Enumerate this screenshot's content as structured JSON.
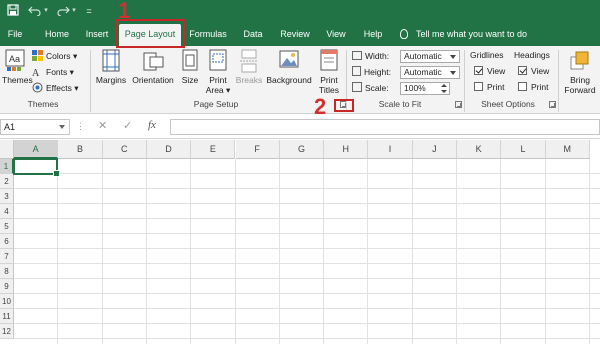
{
  "quick_access": {
    "save_icon": "save-icon",
    "undo_icon": "undo-icon",
    "redo_icon": "redo-icon",
    "customize_icon": "customize-icon"
  },
  "tabs": [
    {
      "label": "File"
    },
    {
      "label": "Home"
    },
    {
      "label": "Insert"
    },
    {
      "label": "Page Layout",
      "active": true
    },
    {
      "label": "Formulas"
    },
    {
      "label": "Data"
    },
    {
      "label": "Review"
    },
    {
      "label": "View"
    },
    {
      "label": "Help"
    }
  ],
  "tell_me": "Tell me what you want to do",
  "annotations": {
    "step1": "1",
    "step2": "2"
  },
  "ribbon": {
    "themes": {
      "themes_label": "Themes",
      "colors_label": "Colors",
      "fonts_label": "Fonts",
      "effects_label": "Effects",
      "group_label": "Themes"
    },
    "page_setup": {
      "margins_label": "Margins",
      "orientation_label": "Orientation",
      "size_label": "Size",
      "print_area_line1": "Print",
      "print_area_line2": "Area",
      "breaks_label": "Breaks",
      "background_label": "Background",
      "print_titles_line1": "Print",
      "print_titles_line2": "Titles",
      "group_label": "Page Setup"
    },
    "scale_to_fit": {
      "width_label": "Width:",
      "width_value": "Automatic",
      "height_label": "Height:",
      "height_value": "Automatic",
      "scale_label": "Scale:",
      "scale_value": "100%",
      "group_label": "Scale to Fit"
    },
    "sheet_options": {
      "gridlines_head": "Gridlines",
      "headings_head": "Headings",
      "view_label": "View",
      "print_label": "Print",
      "gridlines_view": true,
      "gridlines_print": false,
      "headings_view": true,
      "headings_print": false,
      "group_label": "Sheet Options"
    },
    "arrange": {
      "bring_forward_line1": "Bring",
      "bring_forward_line2": "Forward"
    }
  },
  "formula_bar": {
    "name_box": "A1",
    "cancel_icon": "✕",
    "enter_icon": "✓",
    "fx_label": "fx",
    "formula": ""
  },
  "grid": {
    "columns": [
      "A",
      "B",
      "C",
      "D",
      "E",
      "F",
      "G",
      "H",
      "I",
      "J",
      "K",
      "L",
      "M"
    ],
    "rows": [
      "1",
      "2",
      "3",
      "4",
      "5",
      "6",
      "7",
      "8",
      "9",
      "10",
      "11",
      "12"
    ],
    "active_cell": "A1"
  },
  "colors": {
    "excel_green": "#217346",
    "annotation_red": "#c62828"
  }
}
